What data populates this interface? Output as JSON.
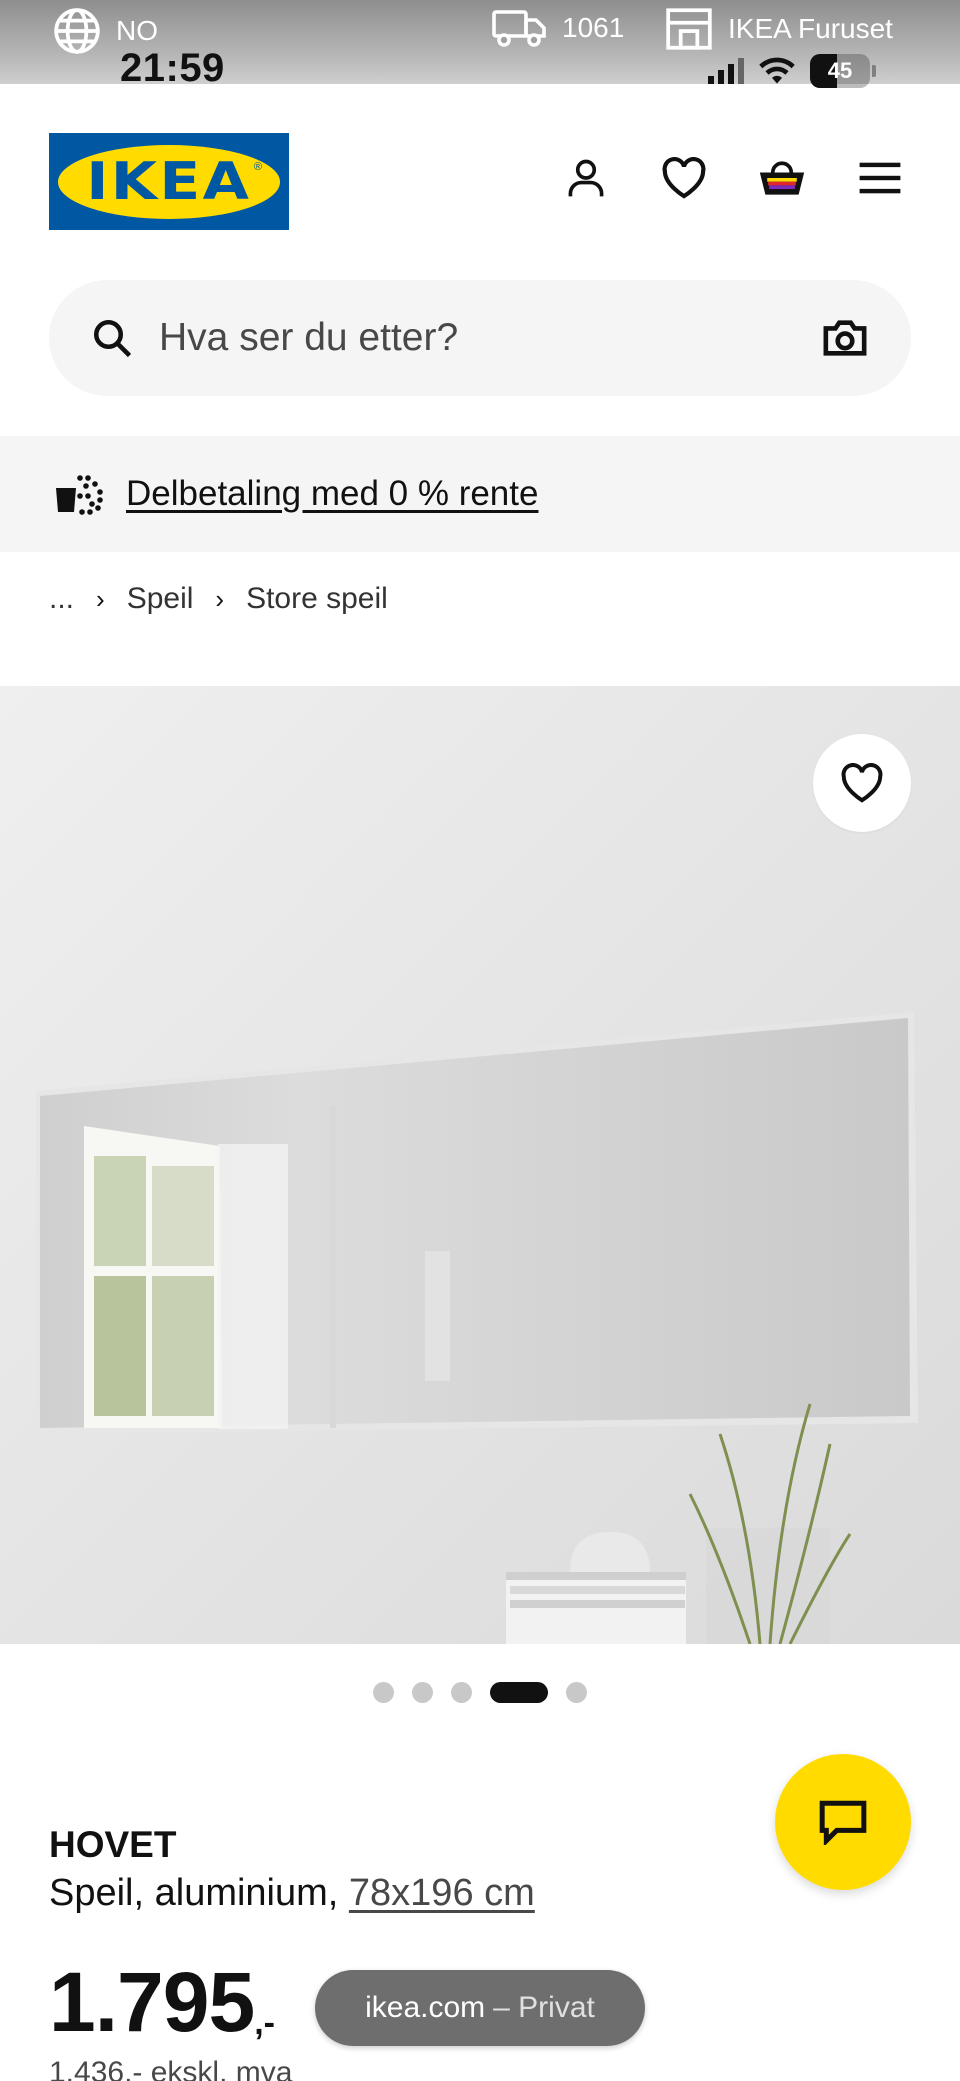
{
  "topbar": {
    "language": "NO",
    "time": "21:59",
    "postcode": "1061",
    "store": "IKEA Furuset",
    "battery": "45"
  },
  "header": {
    "logo_text": "IKEA",
    "brand_colors": {
      "blue": "#0058a3",
      "yellow": "#ffdb00"
    },
    "icons": [
      "profile-icon",
      "heart-icon",
      "basket-icon",
      "menu-icon"
    ]
  },
  "search": {
    "placeholder": "Hva ser du etter?"
  },
  "promo": {
    "link": "Delbetaling med 0 % rente"
  },
  "breadcrumb": {
    "items": [
      "...",
      "Speil",
      "Store speil"
    ]
  },
  "gallery": {
    "total": 5,
    "active_index": 4
  },
  "product": {
    "name": "HOVET",
    "description": "Speil, aluminium, ",
    "size": "78x196 cm",
    "price_integer": "1.795",
    "price_decimal": ",-",
    "price_ex_vat": "1.436,- ekskl. mva"
  },
  "browser": {
    "domain": "ikea.com",
    "mode": "– Privat"
  }
}
